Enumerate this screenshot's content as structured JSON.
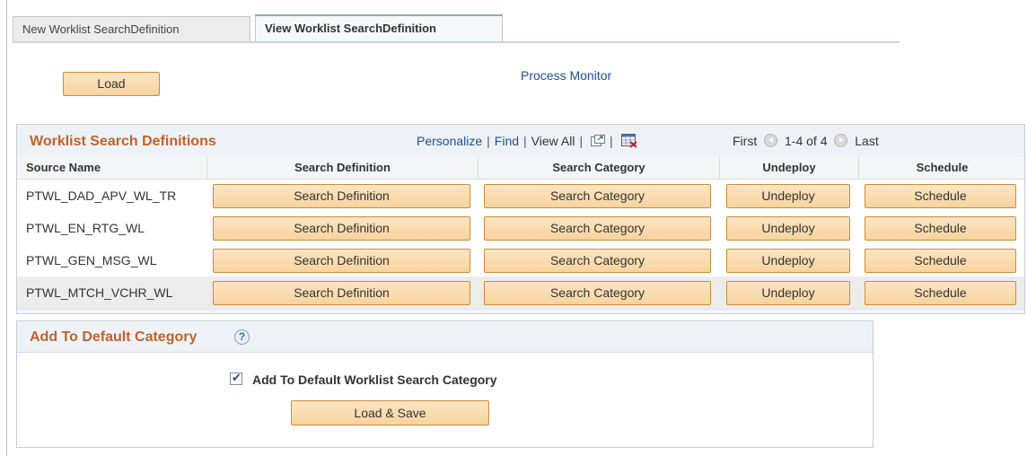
{
  "tabs": [
    {
      "label": "New Worklist SearchDefinition"
    },
    {
      "label": "View Worklist SearchDefinition"
    }
  ],
  "toolbar": {
    "load_label": "Load",
    "process_monitor": "Process Monitor"
  },
  "grid": {
    "title": "Worklist Search Definitions",
    "personalize": "Personalize",
    "find": "Find",
    "view_all": "View All",
    "first": "First",
    "range": "1-4 of 4",
    "last": "Last",
    "columns": [
      "Source Name",
      "Search Definition",
      "Search Category",
      "Undeploy",
      "Schedule"
    ],
    "rows": [
      {
        "source": "PTWL_DAD_APV_WL_TR",
        "search_def": "Search Definition",
        "search_cat": "Search Category",
        "undeploy": "Undeploy",
        "schedule": "Schedule"
      },
      {
        "source": "PTWL_EN_RTG_WL",
        "search_def": "Search Definition",
        "search_cat": "Search Category",
        "undeploy": "Undeploy",
        "schedule": "Schedule"
      },
      {
        "source": "PTWL_GEN_MSG_WL",
        "search_def": "Search Definition",
        "search_cat": "Search Category",
        "undeploy": "Undeploy",
        "schedule": "Schedule"
      },
      {
        "source": "PTWL_MTCH_VCHR_WL",
        "search_def": "Search Definition",
        "search_cat": "Search Category",
        "undeploy": "Undeploy",
        "schedule": "Schedule"
      }
    ]
  },
  "add_default": {
    "title": "Add To Default Category",
    "help": "?",
    "checkbox_label": "Add To Default Worklist Search Category",
    "checked": true,
    "load_save": "Load & Save"
  },
  "icons": {
    "zoom": "zoom-grid-icon",
    "download": "download-excel-icon",
    "prev": "previous-arrow-icon",
    "next": "next-arrow-icon",
    "help": "help-icon"
  },
  "colors": {
    "section_title": "#c0622d",
    "link": "#1f4e8c",
    "button": "#f7d39e"
  }
}
